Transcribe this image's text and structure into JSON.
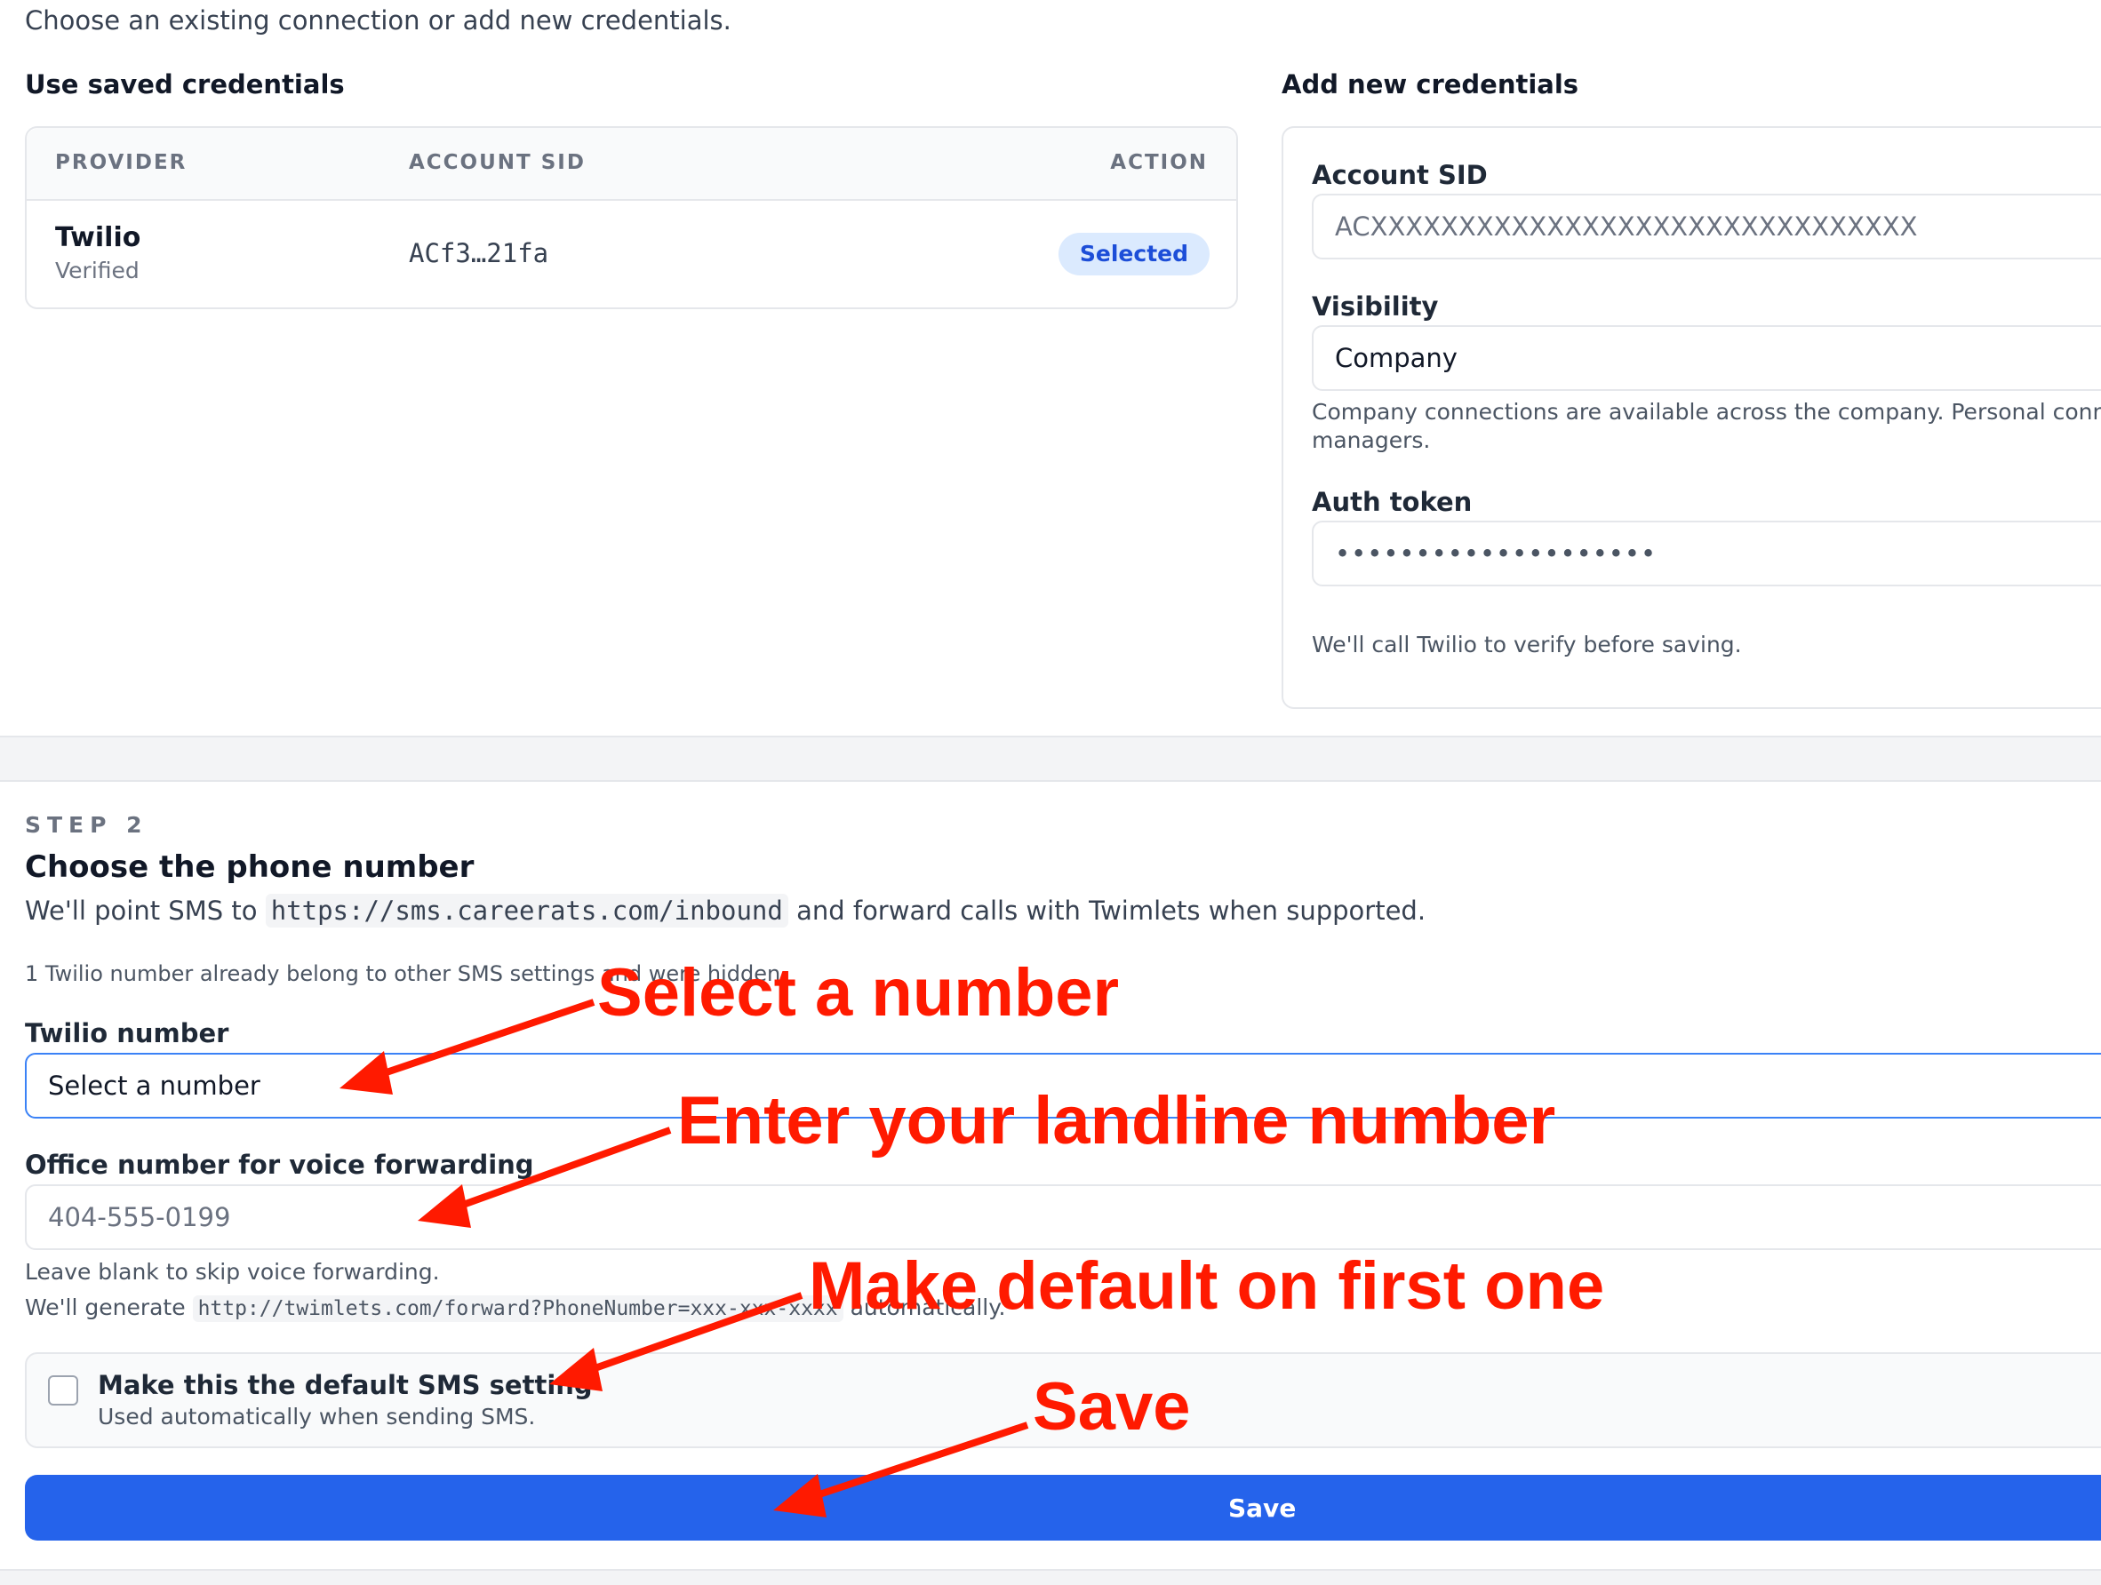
{
  "intro": "Choose an existing connection or add new credentials.",
  "saved": {
    "title": "Use saved credentials",
    "columns": [
      "PROVIDER",
      "ACCOUNT SID",
      "ACTION"
    ],
    "row": {
      "provider": "Twilio",
      "status": "Verified",
      "sid": "ACf3…21fa",
      "action": "Selected"
    }
  },
  "new_creds": {
    "title": "Add new credentials",
    "account_sid_label": "Account SID",
    "account_sid_placeholder": "ACXXXXXXXXXXXXXXXXXXXXXXXXXXXXXXX",
    "visibility_label": "Visibility",
    "visibility_value": "Company",
    "visibility_help_1": "Company connections are available across the company. Personal conne",
    "visibility_help_2": "managers.",
    "auth_label": "Auth token",
    "auth_value": "••••••••••••••••••••",
    "verify_note": "We'll call Twilio to verify before saving."
  },
  "step2": {
    "step_label": "STEP 2",
    "title": "Choose the phone number",
    "desc_prefix": "We'll point SMS to",
    "desc_url": "https://sms.careerats.com/inbound",
    "desc_suffix": "and forward calls with Twimlets when supported.",
    "hidden_note": "1 Twilio number already belong to other SMS settings and were hidden.",
    "twilio_label": "Twilio number",
    "twilio_value": "Select a number",
    "office_label": "Office number for voice forwarding",
    "office_placeholder": "404-555-0199",
    "office_help_1": "Leave blank to skip voice forwarding.",
    "office_help_2_prefix": "We'll generate",
    "office_help_2_code": "http://twimlets.com/forward?PhoneNumber=xxx-xxx-xxxx",
    "office_help_2_suffix": "automatically.",
    "default_label": "Make this the default SMS setting",
    "default_sub": "Used automatically when sending SMS.",
    "save_label": "Save"
  },
  "annotations": {
    "select_number": "Select a number",
    "enter_landline": "Enter your landline number",
    "make_default": "Make default on first one",
    "save": "Save",
    "color": "#ff1a00"
  }
}
